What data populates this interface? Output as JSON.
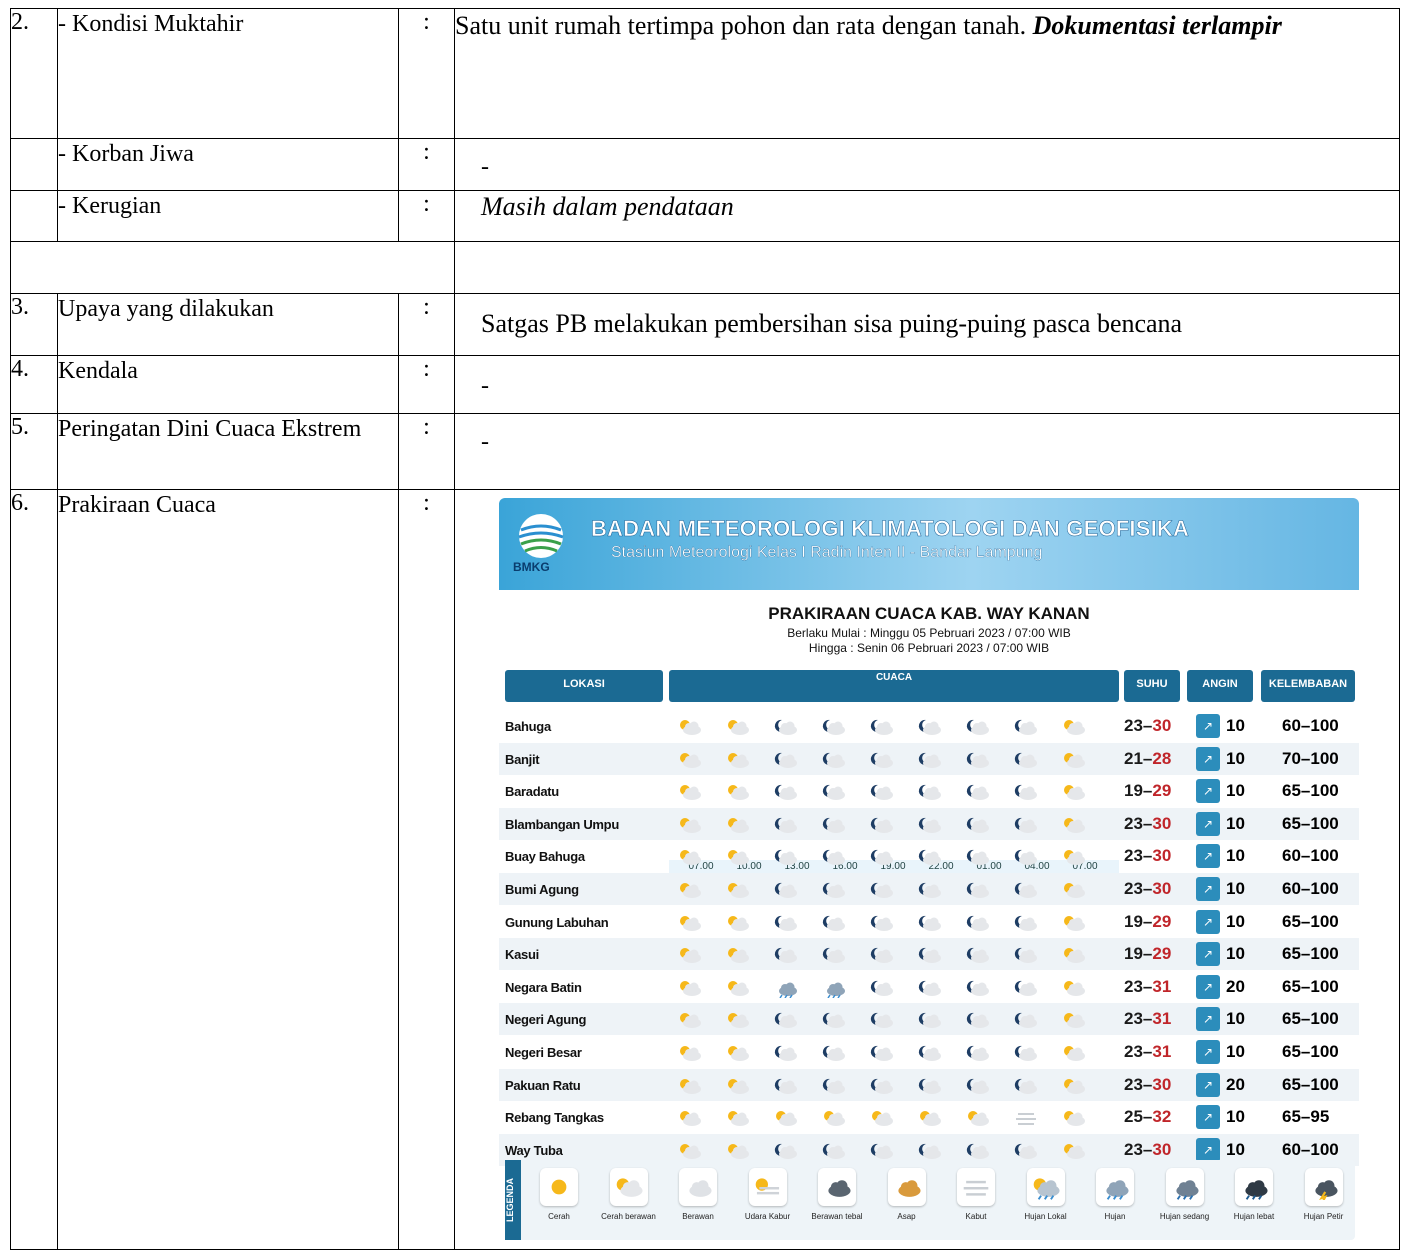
{
  "rows": {
    "r2": {
      "no": "2.",
      "label": "- Kondisi Muktahir",
      "colon": ":",
      "value_plain": "Satu unit rumah tertimpa pohon dan rata dengan tanah. ",
      "value_bold": "Dokumentasi terlampir"
    },
    "korban": {
      "label": "- Korban Jiwa",
      "colon": ":",
      "value": "-"
    },
    "kerugian": {
      "label": "- Kerugian",
      "colon": ":",
      "value": "Masih dalam pendataan"
    },
    "r3": {
      "no": "3.",
      "label": "Upaya yang dilakukan",
      "colon": ":",
      "value": "Satgas PB  melakukan pembersihan sisa puing-puing pasca bencana"
    },
    "r4": {
      "no": "4.",
      "label": "Kendala",
      "colon": ":",
      "value": "-"
    },
    "r5": {
      "no": "5.",
      "label": "Peringatan Dini Cuaca Ekstrem",
      "colon": ":",
      "value": "-"
    },
    "r6": {
      "no": "6.",
      "label": "Prakiraan Cuaca",
      "colon": ":"
    }
  },
  "forecast": {
    "agency": "BADAN METEOROLOGI KLIMATOLOGI DAN GEOFISIKA",
    "station": "Stasiun Meteorologi Kelas I Radin Inten II - Bandar Lampung",
    "logo_text": "BMKG",
    "title": "PRAKIRAAN CUACA KAB. WAY KANAN",
    "valid_from": "Berlaku Mulai : Minggu 05 Pebruari 2023 / 07:00 WIB",
    "valid_to": "Hingga : Senin 06 Pebruari 2023 / 07:00 WIB",
    "headers": {
      "lokasi": "LOKASI",
      "cuaca": "CUACA",
      "suhu": "SUHU",
      "angin": "ANGIN",
      "kelembaban": "KELEMBABAN"
    },
    "times": [
      "07.00",
      "10.00",
      "13.00",
      "16.00",
      "19.00",
      "22.00",
      "01.00",
      "04.00",
      "07.00"
    ],
    "locations": [
      {
        "name": "Bahuga",
        "temp_lo": "23",
        "temp_hi": "30",
        "wind": "10",
        "hum": "60–100",
        "wx": [
          "pc",
          "pc",
          "pcn",
          "pcn",
          "pcn",
          "pcn",
          "pcn",
          "pcn",
          "pc"
        ]
      },
      {
        "name": "Banjit",
        "temp_lo": "21",
        "temp_hi": "28",
        "wind": "10",
        "hum": "70–100",
        "wx": [
          "pc",
          "pc",
          "pcn",
          "pcn",
          "pcn",
          "pcn",
          "pcn",
          "pcn",
          "pc"
        ]
      },
      {
        "name": "Baradatu",
        "temp_lo": "19",
        "temp_hi": "29",
        "wind": "10",
        "hum": "65–100",
        "wx": [
          "pc",
          "pc",
          "pcn",
          "pcn",
          "pcn",
          "pcn",
          "pcn",
          "pcn",
          "pc"
        ]
      },
      {
        "name": "Blambangan Umpu",
        "temp_lo": "23",
        "temp_hi": "30",
        "wind": "10",
        "hum": "65–100",
        "wx": [
          "pc",
          "pc",
          "pcn",
          "pcn",
          "pcn",
          "pcn",
          "pcn",
          "pcn",
          "pc"
        ]
      },
      {
        "name": "Buay Bahuga",
        "temp_lo": "23",
        "temp_hi": "30",
        "wind": "10",
        "hum": "60–100",
        "wx": [
          "pc",
          "pc",
          "pcn",
          "pcn",
          "pcn",
          "pcn",
          "pcn",
          "pcn",
          "pc"
        ]
      },
      {
        "name": "Bumi Agung",
        "temp_lo": "23",
        "temp_hi": "30",
        "wind": "10",
        "hum": "60–100",
        "wx": [
          "pc",
          "pc",
          "pcn",
          "pcn",
          "pcn",
          "pcn",
          "pcn",
          "pcn",
          "pc"
        ]
      },
      {
        "name": "Gunung Labuhan",
        "temp_lo": "19",
        "temp_hi": "29",
        "wind": "10",
        "hum": "65–100",
        "wx": [
          "pc",
          "pc",
          "pcn",
          "pcn",
          "pcn",
          "pcn",
          "pcn",
          "pcn",
          "pc"
        ]
      },
      {
        "name": "Kasui",
        "temp_lo": "19",
        "temp_hi": "29",
        "wind": "10",
        "hum": "65–100",
        "wx": [
          "pc",
          "pc",
          "pcn",
          "pcn",
          "pcn",
          "pcn",
          "pcn",
          "pcn",
          "pc"
        ]
      },
      {
        "name": "Negara Batin",
        "temp_lo": "23",
        "temp_hi": "31",
        "wind": "20",
        "hum": "65–100",
        "wx": [
          "pc",
          "pc",
          "rain",
          "rain",
          "pcn",
          "pcn",
          "pcn",
          "pcn",
          "pc"
        ]
      },
      {
        "name": "Negeri Agung",
        "temp_lo": "23",
        "temp_hi": "31",
        "wind": "10",
        "hum": "65–100",
        "wx": [
          "pc",
          "pc",
          "pcn",
          "pcn",
          "pcn",
          "pcn",
          "pcn",
          "pcn",
          "pc"
        ]
      },
      {
        "name": "Negeri Besar",
        "temp_lo": "23",
        "temp_hi": "31",
        "wind": "10",
        "hum": "65–100",
        "wx": [
          "pc",
          "pc",
          "pcn",
          "pcn",
          "pcn",
          "pcn",
          "pcn",
          "pcn",
          "pc"
        ]
      },
      {
        "name": "Pakuan Ratu",
        "temp_lo": "23",
        "temp_hi": "30",
        "wind": "20",
        "hum": "65–100",
        "wx": [
          "pc",
          "pc",
          "pcn",
          "pcn",
          "pcn",
          "pcn",
          "pcn",
          "pcn",
          "pc"
        ]
      },
      {
        "name": "Rebang Tangkas",
        "temp_lo": "25",
        "temp_hi": "32",
        "wind": "10",
        "hum": "65–95",
        "wx": [
          "pc",
          "pc",
          "pc",
          "pc",
          "pc",
          "pc",
          "pc",
          "fog",
          "pc"
        ]
      },
      {
        "name": "Way Tuba",
        "temp_lo": "23",
        "temp_hi": "30",
        "wind": "10",
        "hum": "60–100",
        "wx": [
          "pc",
          "pc",
          "pcn",
          "pcn",
          "pcn",
          "pcn",
          "pcn",
          "pcn",
          "pc"
        ]
      }
    ],
    "legend_title": "LEGENDA",
    "legend": [
      {
        "label": "Cerah",
        "icon": "sun"
      },
      {
        "label": "Cerah berawan",
        "icon": "pc"
      },
      {
        "label": "Berawan",
        "icon": "cloud"
      },
      {
        "label": "Udara Kabur",
        "icon": "haze"
      },
      {
        "label": "Berawan tebal",
        "icon": "dark-cloud"
      },
      {
        "label": "Asap",
        "icon": "smoke"
      },
      {
        "label": "Kabut",
        "icon": "fog"
      },
      {
        "label": "Hujan Lokal",
        "icon": "local-rain"
      },
      {
        "label": "Hujan",
        "icon": "rain"
      },
      {
        "label": "Hujan sedang",
        "icon": "rain-mod"
      },
      {
        "label": "Hujan lebat",
        "icon": "rain-heavy"
      },
      {
        "label": "Hujan Petir",
        "icon": "storm"
      }
    ]
  }
}
